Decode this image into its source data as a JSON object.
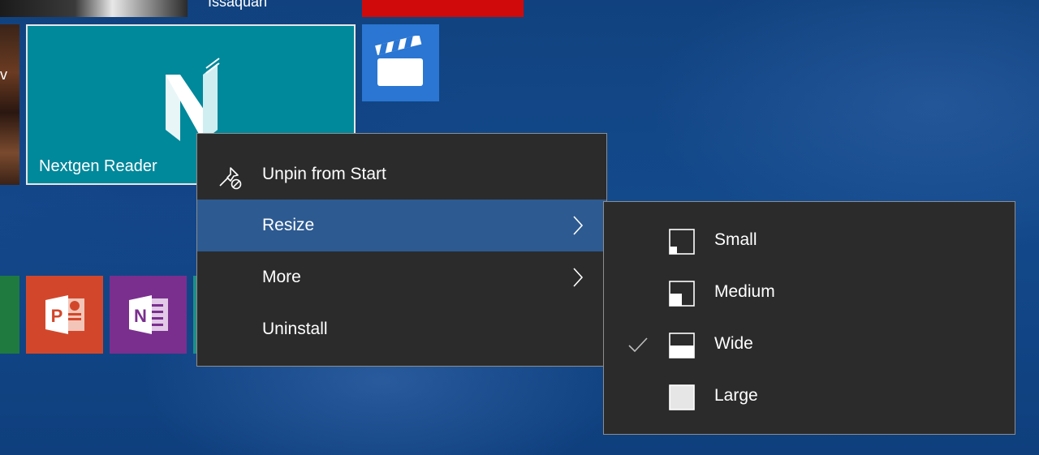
{
  "tiles": {
    "top_partial_label": "Issaquah",
    "left_partial_label": "v",
    "nextgen_reader_label": "Nextgen Reader"
  },
  "context_menu": {
    "unpin_label": "Unpin from Start",
    "resize_label": "Resize",
    "more_label": "More",
    "uninstall_label": "Uninstall"
  },
  "resize_submenu": {
    "small_label": "Small",
    "medium_label": "Medium",
    "wide_label": "Wide",
    "large_label": "Large",
    "selected": "Wide"
  },
  "colors": {
    "menu_background": "#2b2b2b",
    "menu_highlight": "#2d5a91",
    "nextgen_tile": "#00889b",
    "movies_tile": "#2a76d2",
    "powerpoint_tile": "#d2472b",
    "onenote_tile": "#7a2f8e"
  }
}
